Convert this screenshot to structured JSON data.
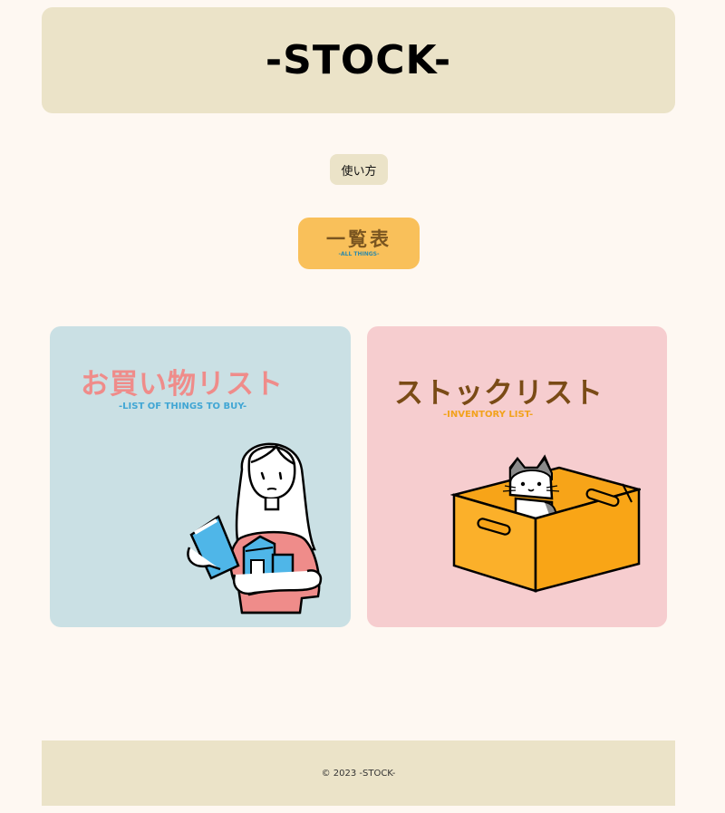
{
  "header": {
    "logo": "-STOCK-"
  },
  "nav": {
    "howto_label": "使い方",
    "all_list": {
      "title": "一覧表",
      "subtitle": "-ALL THINGS-"
    }
  },
  "cards": {
    "shopping": {
      "title": "お買い物リスト",
      "subtitle": "-LIST OF THINGS TO BUY-",
      "illustration": "girl-holding-groceries"
    },
    "stock": {
      "title": "ストックリスト",
      "subtitle": "-INVENTORY LIST-",
      "illustration": "cat-in-box"
    }
  },
  "footer": {
    "copyright": "© 2023 -STOCK-"
  },
  "colors": {
    "background": "#fef8f2",
    "header_bg": "#ebe3c8",
    "all_list_bg": "#f9c05a",
    "shopping_card_bg": "#cae0e4",
    "stock_card_bg": "#f6cdcf"
  }
}
